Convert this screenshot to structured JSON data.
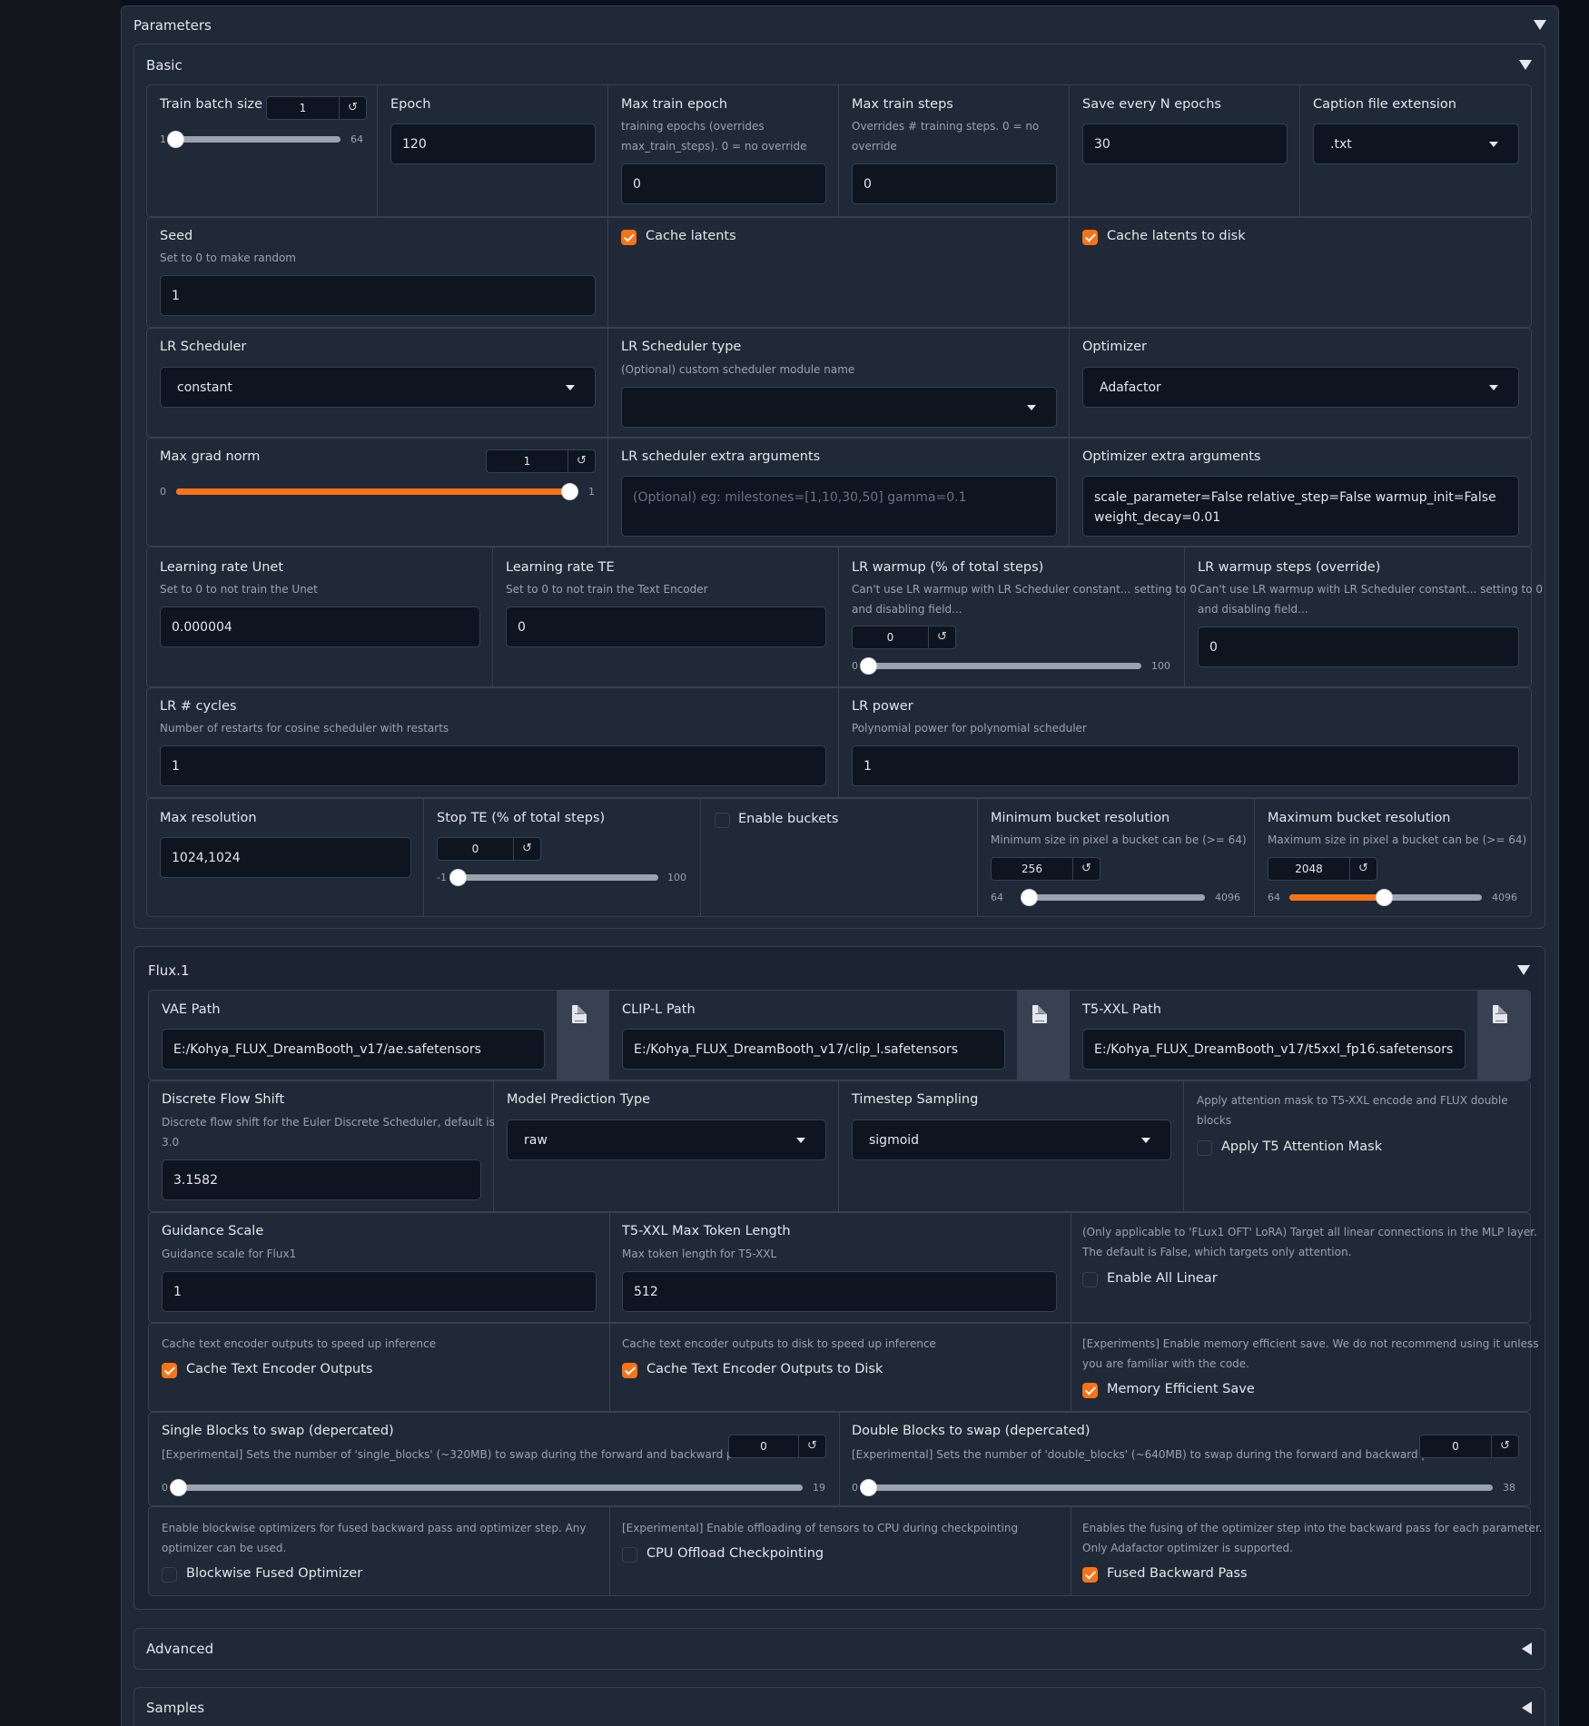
{
  "parameters_title": "Parameters",
  "basic": {
    "title": "Basic",
    "train_batch_size": {
      "label": "Train batch size",
      "value": "1",
      "min": "1",
      "max": "64",
      "fraction": 0.0
    },
    "epoch": {
      "label": "Epoch",
      "value": "120"
    },
    "max_train_epoch": {
      "label": "Max train epoch",
      "info1": "training epochs (overrides",
      "info2": "max_train_steps). 0 = no override",
      "value": "0"
    },
    "max_train_steps": {
      "label": "Max train steps",
      "info1": "Overrides # training steps. 0 = no",
      "info2": "override",
      "value": "0"
    },
    "save_every_n_epochs": {
      "label": "Save every N epochs",
      "value": "30"
    },
    "caption_ext": {
      "label": "Caption file extension",
      "value": ".txt"
    },
    "seed": {
      "label": "Seed",
      "info": "Set to 0 to make random",
      "value": "1"
    },
    "cache_latents": {
      "label": "Cache latents",
      "checked": true
    },
    "cache_latents_to_disk": {
      "label": "Cache latents to disk",
      "checked": true
    },
    "lr_scheduler": {
      "label": "LR Scheduler",
      "value": "constant"
    },
    "lr_scheduler_type": {
      "label": "LR Scheduler type",
      "info": "(Optional) custom scheduler module name",
      "value": ""
    },
    "optimizer": {
      "label": "Optimizer",
      "value": "Adafactor"
    },
    "max_grad_norm": {
      "label": "Max grad norm",
      "value": "1",
      "min": "0",
      "max": "1",
      "fraction": 1.0
    },
    "lr_scheduler_args": {
      "label": "LR scheduler extra arguments",
      "placeholder": "(Optional) eg: milestones=[1,10,30,50] gamma=0.1"
    },
    "optimizer_args": {
      "label": "Optimizer extra arguments",
      "value": "scale_parameter=False relative_step=False warmup_init=False weight_decay=0.01"
    },
    "lr_unet": {
      "label": "Learning rate Unet",
      "info": "Set to 0 to not train the Unet",
      "value": "0.000004"
    },
    "lr_te": {
      "label": "Learning rate TE",
      "info": "Set to 0 to not train the Text Encoder",
      "value": "0"
    },
    "lr_warmup": {
      "label": "LR warmup (% of total steps)",
      "info1": "Can't use LR warmup with LR Scheduler constant... setting to 0",
      "info2": "and disabling field...",
      "value": "0",
      "min": "0",
      "max": "100",
      "fraction": 0.0
    },
    "lr_warmup_steps": {
      "label": "LR warmup steps (override)",
      "info1": "Can't use LR warmup with LR Scheduler constant... setting to 0",
      "info2": "and disabling field...",
      "value": "0"
    },
    "lr_cycles": {
      "label": "LR # cycles",
      "info": "Number of restarts for cosine scheduler with restarts",
      "value": "1"
    },
    "lr_power": {
      "label": "LR power",
      "info": "Polynomial power for polynomial scheduler",
      "value": "1"
    },
    "max_resolution": {
      "label": "Max resolution",
      "value": "1024,1024"
    },
    "stop_te": {
      "label": "Stop TE (% of total steps)",
      "value": "0",
      "min": "-1",
      "max": "100",
      "fraction": 0.0
    },
    "enable_buckets": {
      "label": "Enable buckets",
      "checked": false
    },
    "min_bucket": {
      "label": "Minimum bucket resolution",
      "info": "Minimum size in pixel a bucket can be (>= 64)",
      "value": "256",
      "min": "64",
      "max": "4096",
      "fraction": 0.0
    },
    "max_bucket": {
      "label": "Maximum bucket resolution",
      "info": "Maximum size in pixel a bucket can be (>= 64)",
      "value": "2048",
      "min": "64",
      "max": "4096",
      "fraction": 0.49
    }
  },
  "flux": {
    "title": "Flux.1",
    "vae_path": {
      "label": "VAE Path",
      "value": "E:/Kohya_FLUX_DreamBooth_v17/ae.safetensors"
    },
    "clip_l_path": {
      "label": "CLIP-L Path",
      "value": "E:/Kohya_FLUX_DreamBooth_v17/clip_l.safetensors"
    },
    "t5xxl_path": {
      "label": "T5-XXL Path",
      "value": "E:/Kohya_FLUX_DreamBooth_v17/t5xxl_fp16.safetensors"
    },
    "discrete_flow_shift": {
      "label": "Discrete Flow Shift",
      "info1": "Discrete flow shift for the Euler Discrete Scheduler, default is",
      "info2": "3.0",
      "value": "3.1582"
    },
    "model_prediction_type": {
      "label": "Model Prediction Type",
      "value": "raw"
    },
    "timestep_sampling": {
      "label": "Timestep Sampling",
      "value": "sigmoid"
    },
    "apply_t5_mask": {
      "info1": "Apply attention mask to T5-XXL encode and FLUX double",
      "info2": "blocks",
      "label": "Apply T5 Attention Mask",
      "checked": false
    },
    "guidance_scale": {
      "label": "Guidance Scale",
      "info": "Guidance scale for Flux1",
      "value": "1"
    },
    "t5xxl_max_token": {
      "label": "T5-XXL Max Token Length",
      "info": "Max token length for T5-XXL",
      "value": "512"
    },
    "enable_all_linear": {
      "info1": "(Only applicable to 'FLux1 OFT' LoRA) Target all linear connections in the MLP layer.",
      "info2": "The default is False, which targets only attention.",
      "label": "Enable All Linear",
      "checked": false
    },
    "cache_te_outputs": {
      "info": "Cache text encoder outputs to speed up inference",
      "label": "Cache Text Encoder Outputs",
      "checked": true
    },
    "cache_te_outputs_disk": {
      "info": "Cache text encoder outputs to disk to speed up inference",
      "label": "Cache Text Encoder Outputs to Disk",
      "checked": true
    },
    "mem_eff_save": {
      "info1": "[Experiments] Enable memory efficient save. We do not recommend using it unless",
      "info2": "you are familiar with the code.",
      "label": "Memory Efficient Save",
      "checked": true
    },
    "single_blocks": {
      "label": "Single Blocks to swap (depercated)",
      "info": "[Experimental] Sets the number of 'single_blocks' (~320MB) to swap during the forward and backward passes.",
      "value": "0",
      "min": "0",
      "max": "19",
      "fraction": 0.0
    },
    "double_blocks": {
      "label": "Double Blocks to swap (depercated)",
      "info": "[Experimental] Sets the number of 'double_blocks' (~640MB) to swap during the forward and backward passes.",
      "value": "0",
      "min": "0",
      "max": "38",
      "fraction": 0.0
    },
    "blockwise_fused": {
      "info1": "Enable blockwise optimizers for fused backward pass and optimizer step. Any",
      "info2": "optimizer can be used.",
      "label": "Blockwise Fused Optimizer",
      "checked": false
    },
    "cpu_offload": {
      "info": "[Experimental] Enable offloading of tensors to CPU during checkpointing",
      "label": "CPU Offload Checkpointing",
      "checked": false
    },
    "fused_backward": {
      "info1": "Enables the fusing of the optimizer step into the backward pass for each parameter.",
      "info2": "Only Adafactor optimizer is supported.",
      "label": "Fused Backward Pass",
      "checked": true
    }
  },
  "advanced_title": "Advanced",
  "samples_title": "Samples",
  "icons": {
    "reset": "↺",
    "file": "file-icon",
    "collapse": "triangle-down",
    "expand": "triangle-left"
  },
  "colors": {
    "accent": "#f97316",
    "panel": "#1f2937",
    "background": "#0b0f19"
  }
}
